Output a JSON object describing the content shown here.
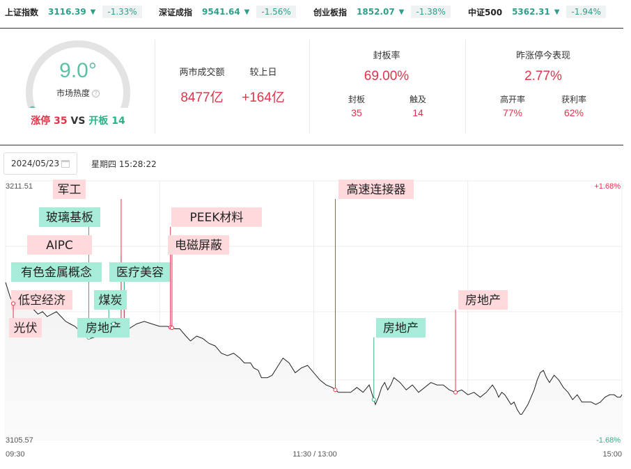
{
  "indices": [
    {
      "name": "上证指数",
      "value": "3116.39",
      "arrow": "▼",
      "change": "-1.33%"
    },
    {
      "name": "深证成指",
      "value": "9541.64",
      "arrow": "▼",
      "change": "-1.56%"
    },
    {
      "name": "创业板指",
      "value": "1852.07",
      "arrow": "▼",
      "change": "-1.38%"
    },
    {
      "name": "中证500",
      "value": "5362.31",
      "arrow": "▼",
      "change": "-1.94%"
    }
  ],
  "heat": {
    "value": 9.0,
    "value_text": "9.0°",
    "label": "市场热度",
    "info_icon": "info-circle-icon",
    "limit_up_label": "涨停",
    "limit_up_count": "35",
    "vs": "VS",
    "open_board_label": "开板",
    "open_board_count": "14"
  },
  "turnover": {
    "label": "两市成交额",
    "value": "8477亿",
    "compare_label": "较上日",
    "compare_value": "+164亿"
  },
  "seal": {
    "title": "封板率",
    "rate": "69.00%",
    "sealed_label": "封板",
    "sealed_value": "35",
    "touched_label": "触及",
    "touched_value": "14"
  },
  "yesterday": {
    "title": "昨涨停今表现",
    "value": "2.77%",
    "high_open_label": "高开率",
    "high_open_value": "77%",
    "profit_label": "获利率",
    "profit_value": "62%"
  },
  "date": {
    "value": "2024/05/23",
    "calendar_icon": "calendar-icon",
    "weekday_time": "星期四 15:28:22"
  },
  "colors": {
    "red": "#e0344b",
    "green": "#2fb187",
    "tag_red_bg": "#ffd9dc",
    "tag_green_bg": "#a7ecd8"
  },
  "chart_data": {
    "type": "line",
    "y_top_label": "3211.51",
    "y_bottom_label": "3105.57",
    "pct_top_label": "+1.68%",
    "pct_bottom_label": "-1.68%",
    "ylim": [
      3105.57,
      3211.51
    ],
    "x_labels": [
      "09:30",
      "11:30 / 13:00",
      "15:00"
    ],
    "series": [
      {
        "values": [
          [
            0,
            3170
          ],
          [
            3,
            3164
          ],
          [
            6,
            3160
          ],
          [
            9,
            3163
          ],
          [
            12,
            3164
          ],
          [
            15,
            3161
          ],
          [
            18,
            3159
          ],
          [
            21,
            3157
          ],
          [
            24,
            3158
          ],
          [
            27,
            3156
          ],
          [
            30,
            3157
          ],
          [
            33,
            3158
          ],
          [
            36,
            3156
          ],
          [
            39,
            3154
          ],
          [
            42,
            3153
          ],
          [
            45,
            3152
          ],
          [
            50,
            3149
          ],
          [
            55,
            3147
          ],
          [
            60,
            3148
          ],
          [
            65,
            3150
          ],
          [
            70,
            3153
          ],
          [
            75,
            3152
          ],
          [
            80,
            3151
          ],
          [
            85,
            3153
          ],
          [
            90,
            3154
          ],
          [
            95,
            3153
          ],
          [
            100,
            3152
          ],
          [
            105,
            3152
          ],
          [
            110,
            3151
          ],
          [
            113,
            3151
          ],
          [
            117,
            3148
          ],
          [
            120,
            3146
          ],
          [
            124,
            3148
          ],
          [
            128,
            3147
          ],
          [
            132,
            3145
          ],
          [
            136,
            3144
          ],
          [
            140,
            3141
          ],
          [
            144,
            3140
          ],
          [
            148,
            3141
          ],
          [
            152,
            3139
          ],
          [
            155,
            3137
          ],
          [
            159,
            3137
          ],
          [
            161,
            3135
          ],
          [
            164,
            3134
          ],
          [
            166,
            3131
          ],
          [
            170,
            3131
          ],
          [
            173,
            3132
          ],
          [
            177,
            3136
          ],
          [
            180,
            3139
          ],
          [
            184,
            3137
          ],
          [
            188,
            3133
          ],
          [
            192,
            3135
          ],
          [
            196,
            3136
          ],
          [
            200,
            3133
          ],
          [
            204,
            3130
          ],
          [
            208,
            3128
          ],
          [
            212,
            3127
          ],
          [
            216,
            3125
          ],
          [
            220,
            3125
          ],
          [
            224,
            3125
          ],
          [
            228,
            3127
          ],
          [
            232,
            3125
          ],
          [
            236,
            3128
          ],
          [
            238,
            3124
          ],
          [
            240,
            3120
          ],
          [
            242,
            3123
          ],
          [
            244,
            3127
          ],
          [
            246,
            3129
          ],
          [
            248,
            3126
          ],
          [
            250,
            3128
          ],
          [
            252,
            3131
          ],
          [
            256,
            3129
          ],
          [
            260,
            3126
          ],
          [
            264,
            3128
          ],
          [
            268,
            3125
          ],
          [
            272,
            3127
          ],
          [
            276,
            3129
          ],
          [
            280,
            3128
          ],
          [
            284,
            3128
          ],
          [
            288,
            3126
          ],
          [
            292,
            3125
          ],
          [
            296,
            3126
          ],
          [
            300,
            3124
          ],
          [
            304,
            3125
          ],
          [
            308,
            3123
          ],
          [
            312,
            3125
          ],
          [
            316,
            3128
          ],
          [
            318,
            3126
          ],
          [
            320,
            3123
          ],
          [
            322,
            3125
          ],
          [
            324,
            3124
          ],
          [
            326,
            3122
          ],
          [
            328,
            3120
          ],
          [
            330,
            3121
          ],
          [
            332,
            3118
          ],
          [
            334,
            3116
          ],
          [
            335,
            3116
          ],
          [
            337,
            3118
          ],
          [
            339,
            3120
          ],
          [
            341,
            3123
          ],
          [
            343,
            3126
          ],
          [
            345,
            3130
          ],
          [
            347,
            3133
          ],
          [
            349,
            3134
          ],
          [
            351,
            3131
          ],
          [
            353,
            3129
          ],
          [
            356,
            3132
          ],
          [
            359,
            3130
          ],
          [
            362,
            3127
          ],
          [
            365,
            3125
          ],
          [
            368,
            3122
          ],
          [
            371,
            3124
          ],
          [
            374,
            3121
          ],
          [
            377,
            3121
          ],
          [
            380,
            3121
          ],
          [
            383,
            3120
          ],
          [
            386,
            3121
          ],
          [
            389,
            3123
          ],
          [
            392,
            3124
          ],
          [
            395,
            3124
          ],
          [
            397,
            3123
          ],
          [
            399,
            3123
          ],
          [
            400,
            3124
          ]
        ]
      }
    ],
    "annotations": [
      {
        "label": "军工",
        "t": 75,
        "color": "red"
      },
      {
        "label": "玻璃基板",
        "t": 54,
        "color": "green"
      },
      {
        "label": "AIPC",
        "t": 75,
        "color": "red"
      },
      {
        "label": "有色金属概念",
        "t": 77,
        "color": "green"
      },
      {
        "label": "医疗美容",
        "t": 77,
        "color": "green"
      },
      {
        "label": "低空经济",
        "t": 77,
        "color": "red"
      },
      {
        "label": "煤炭",
        "t": 67,
        "color": "green"
      },
      {
        "label": "光伏",
        "t": 5,
        "color": "red"
      },
      {
        "label": "房地产",
        "t": 70,
        "color": "green"
      },
      {
        "label": "PEEK材料",
        "t": 107,
        "color": "red"
      },
      {
        "label": "电磁屏蔽",
        "t": 108,
        "color": "red"
      },
      {
        "label": "高速连接器",
        "t": 214,
        "color": "red"
      },
      {
        "label": "房地产",
        "t": 239,
        "color": "green"
      },
      {
        "label": "房地产",
        "t": 292,
        "color": "red"
      }
    ]
  }
}
